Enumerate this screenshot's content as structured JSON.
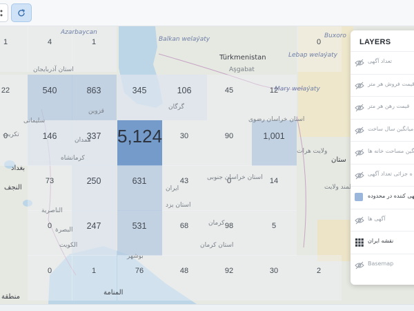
{
  "toolbar": {
    "refresh_icon": "refresh-icon"
  },
  "map": {
    "labels": {
      "azarbaycan": "Azarbaycan",
      "buxoro": "Buxoro",
      "balkan": "Balkan welaýaty",
      "turkmenistan": "Türkmenistan",
      "lebap": "Lebap welaýaty",
      "asgabat": "Aşgabat",
      "mary": "Mary welaýaty",
      "azerbaijan_east": "استان آذربایجان",
      "qazvin": "قزوین",
      "gorgan": "گرگان",
      "khorasan": "استان خراسان رضوی",
      "soleymani": "سلیمانی",
      "hamedan": "همدان",
      "kermanshah": "کرمانشاه",
      "wilayat": "ولایت هرات",
      "afghanistan": "ستان",
      "baghdad": "بغداد",
      "najaf": "النجف",
      "iran": "ایران",
      "yazd": "استان یزد",
      "khorasan_south": "استان خراسان جنوبی",
      "helmand": "هلمند ولایت",
      "nasiriya": "الناصرية",
      "basra": "البصرة",
      "kerman": "کرمان",
      "kerman_prov": "استان کرمان",
      "kuwait": "الكويت",
      "bushehr": "بوشهر",
      "region": "منطقة",
      "manama": "المنامة",
      "tikrit": "تکریت"
    }
  },
  "grid": {
    "rows": [
      [
        "1",
        "4",
        "1",
        "",
        "",
        "",
        "",
        "0"
      ],
      [
        "22",
        "540",
        "863",
        "345",
        "106",
        "45",
        "12",
        ""
      ],
      [
        "0",
        "146",
        "337",
        "5,124",
        "30",
        "90",
        "1,001",
        ""
      ],
      [
        "",
        "73",
        "250",
        "631",
        "43",
        "0",
        "14",
        ""
      ],
      [
        "",
        "0",
        "247",
        "531",
        "68",
        "98",
        "5",
        ""
      ],
      [
        "",
        "0",
        "1",
        "76",
        "48",
        "92",
        "30",
        "2"
      ]
    ]
  },
  "layers": {
    "title": "LAYERS",
    "items": [
      {
        "label": "تعداد آگهی",
        "icon": "eye-off-icon"
      },
      {
        "label": "قیمت فروش هر متر",
        "icon": "eye-off-icon"
      },
      {
        "label": "قیمت رهن هر متر",
        "icon": "eye-off-icon"
      },
      {
        "label": "میانگین سال ساخت",
        "icon": "eye-off-icon"
      },
      {
        "label": "انگین مساحت خانه ها",
        "icon": "eye-off-icon"
      },
      {
        "label": "ه جزائی تعداد آگهی",
        "icon": "eye-off-icon"
      },
      {
        "label": "آگهی کننده در محدوده",
        "icon": "color-swatch",
        "color": "#9ab6da"
      },
      {
        "label": "آگهی ها",
        "icon": "eye-off-icon"
      },
      {
        "label": "نقشه ایران",
        "icon": "grid-icon"
      },
      {
        "label": "Basemap",
        "icon": "eye-off-icon"
      }
    ]
  },
  "colors": {
    "accent": "#cfe2f6",
    "cell_high": "#6f97c8",
    "cell_medium": "#b7cbe2",
    "cell_low": "#dde6ef"
  }
}
